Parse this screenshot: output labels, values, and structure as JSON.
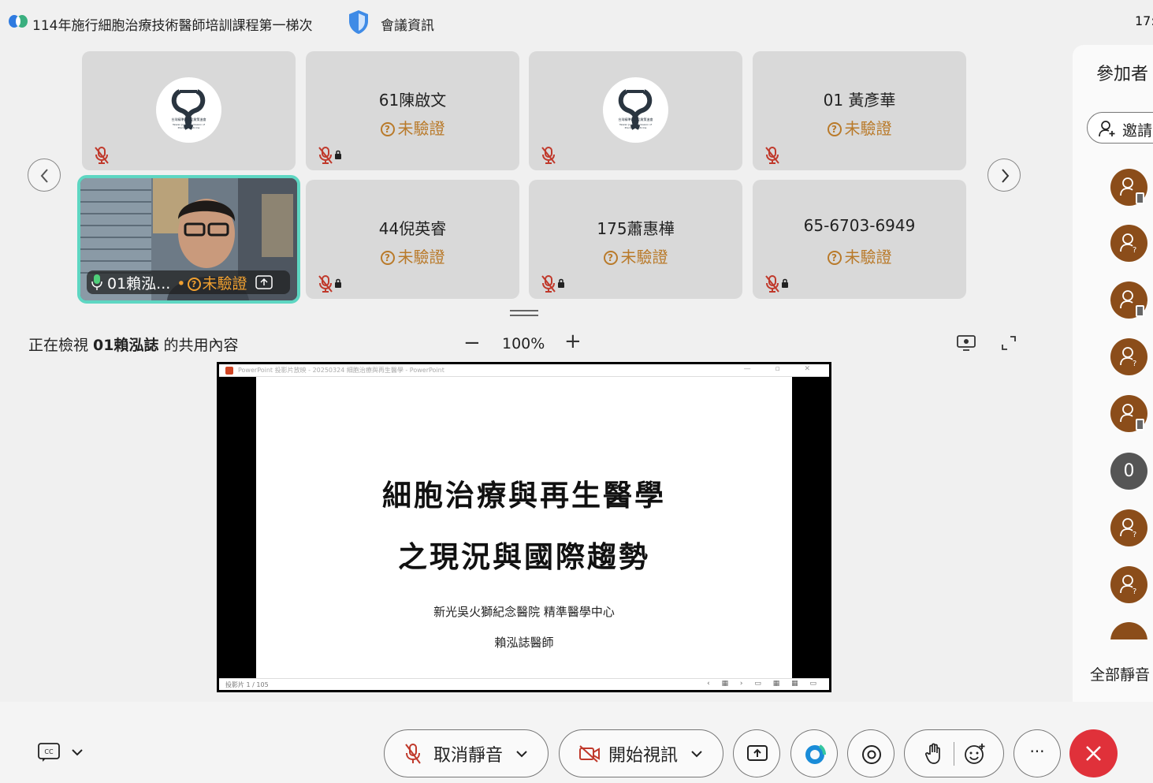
{
  "header": {
    "meeting_title": "114年施行細胞治療技術醫師培訓課程第一梯次",
    "meeting_info": "會議資訊",
    "clock": "17:"
  },
  "tiles": [
    {
      "name": "",
      "status": ""
    },
    {
      "name": "61陳啟文",
      "status": "未驗證"
    },
    {
      "name": "",
      "status": ""
    },
    {
      "name": "01 黃彥華",
      "status": "未驗證"
    },
    {
      "name": "44倪英睿",
      "status": "未驗證"
    },
    {
      "name": "175蕭惠樺",
      "status": "未驗證"
    },
    {
      "name": "65-6703-6949",
      "status": "未驗證"
    }
  ],
  "active_video": {
    "name": "01賴泓...",
    "status": "未驗證"
  },
  "share_view": {
    "viewing_prefix": "正在檢視 ",
    "presenter": "01賴泓誌",
    "viewing_suffix": " 的共用內容",
    "zoom_minus": "−",
    "zoom_level": "100%",
    "zoom_plus": "+"
  },
  "slide": {
    "window_title": "PowerPoint 投影片放映 - 20250324 細胞治療與再生醫學 - PowerPoint",
    "window_buttons": "— ▫ ✕",
    "line1": "細胞治療與再生醫學",
    "line2": "之現況與國際趨勢",
    "institution": "新光吳火獅紀念醫院 精準醫學中心",
    "doctor": "賴泓誌醫師",
    "slide_counter": "投影片 1 / 105",
    "status_buttons": "‹ ▦ › ▭ ▦ ▦ ▭"
  },
  "participants_panel": {
    "title": "參加者",
    "invite_label": "邀請",
    "avatar_count_label": "0",
    "mute_all_label": "全部靜音"
  },
  "controls": {
    "unmute_label": "取消靜音",
    "start_video_label": "開始視訊",
    "more_label": "···"
  },
  "colors": {
    "accent_teal": "#5ed6c2",
    "unverified": "#b97a2a",
    "mute_red": "#c0392b",
    "leave_red": "#e0313a",
    "avatar_brown": "#8b4d1a"
  },
  "icons": [
    "webex-logo",
    "shield-icon",
    "mic-muted-icon",
    "lock-icon",
    "chevron-left-icon",
    "chevron-right-icon",
    "mic-icon",
    "share-icon",
    "view-icon",
    "expand-icon",
    "person-add-icon",
    "guest-user-icon",
    "cc-icon",
    "video-off-icon",
    "ai-assistant-icon",
    "record-icon",
    "hand-icon",
    "reaction-icon",
    "close-icon"
  ]
}
